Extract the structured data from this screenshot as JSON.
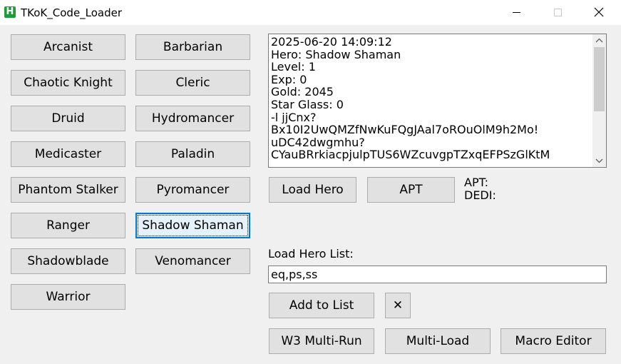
{
  "window": {
    "title": "TKoK_Code_Loader",
    "icon_letter": "H"
  },
  "heroes": [
    "Arcanist",
    "Barbarian",
    "Chaotic Knight",
    "Cleric",
    "Druid",
    "Hydromancer",
    "Medicaster",
    "Paladin",
    "Phantom Stalker",
    "Pyromancer",
    "Ranger",
    "Shadow Shaman",
    "Shadowblade",
    "Venomancer",
    "Warrior"
  ],
  "selected_hero": "Shadow Shaman",
  "log": {
    "lines": [
      "2025-06-20 14:09:12",
      "Hero: Shadow Shaman",
      "Level: 1",
      "Exp: 0",
      "Gold: 2045",
      "Star Glass: 0",
      "-l jjCnx?",
      "Bx10I2UwQMZfNwKuFQgJAal7oROuOlM9h2Mo!",
      "uDC42dwgmhu?",
      "CYauBRrkiacpjulpTUS6WZcuvgpTZxqEFPSzGlKtM"
    ]
  },
  "actions": {
    "load_hero_label": "Load Hero",
    "apt_label": "APT",
    "apt_status_label": "APT:",
    "dedi_status_label": "DEDI:"
  },
  "hero_list": {
    "label": "Load Hero List:",
    "value": "eq,ps,ss",
    "add_label": "Add to List",
    "clear_symbol": "✕"
  },
  "bottom_buttons": {
    "multi_run_label": "W3 Multi-Run",
    "multi_load_label": "Multi-Load",
    "macro_editor_label": "Macro Editor"
  },
  "colors": {
    "button_face": "#e1e1e1",
    "button_border": "#adadad",
    "focus_border": "#0078d7",
    "icon_green": "#1e9b3b"
  }
}
